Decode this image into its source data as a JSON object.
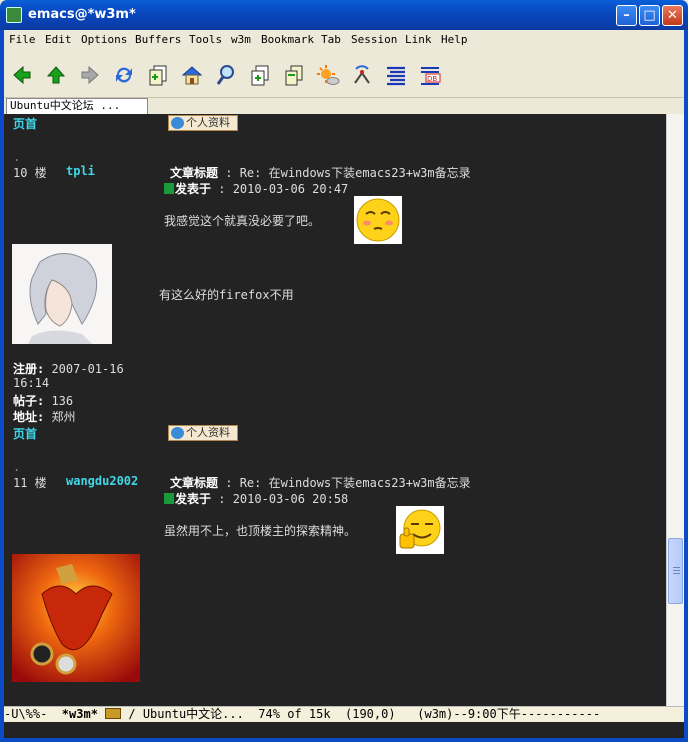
{
  "window": {
    "title": "emacs@*w3m*"
  },
  "menu": [
    "File",
    "Edit",
    "Options",
    "Buffers",
    "Tools",
    "w3m",
    "Bookmark",
    "Tab",
    "Session",
    "Link",
    "Help"
  ],
  "toolbar": [
    "back-icon",
    "up-icon",
    "forward-icon",
    "reload-icon",
    "copy-page-icon",
    "home-icon",
    "search-icon",
    "new-tab-icon",
    "bookmark-icon",
    "weather-icon",
    "antenna-icon",
    "lines-icon",
    "database-icon"
  ],
  "tab": {
    "label": "Ubuntu中文论坛 ..."
  },
  "page": {
    "top_home": "页首",
    "profile_label": "个人资料",
    "post10": {
      "floor": "10 楼",
      "user": "tpli",
      "subject_label": "文章标题",
      "subject": " : Re: 在windows下装emacs23+w3m备忘录",
      "posted_label": "发表于",
      "posted": " : 2010-03-06 20:47",
      "body": "我感觉这个就真没必要了吧。",
      "signature": "有这么好的firefox不用",
      "reg_label": "注册:",
      "reg_date": " 2007-01-16",
      "reg_time": "16:14",
      "posts_label": "帖子:",
      "posts": " 136",
      "addr_label": "地址:",
      "addr": " 郑州",
      "home": "页首"
    },
    "post11": {
      "floor": "11 楼",
      "user": "wangdu2002",
      "subject_label": "文章标题",
      "subject": " : Re: 在windows下装emacs23+w3m备忘录",
      "posted_label": "发表于",
      "posted": " : 2010-03-06 20:58",
      "body": "虽然用不上，也顶楼主的探索精神。"
    }
  },
  "modeline": {
    "left": "-U\\%%-  ",
    "buffer": "*w3m*",
    "rest": " / Ubuntu中文论...  74% of 15k  (190,0)   (w3m)--9:00下午-----------"
  },
  "colors": {
    "accent": "#3fd6e8",
    "bg": "#232323"
  }
}
